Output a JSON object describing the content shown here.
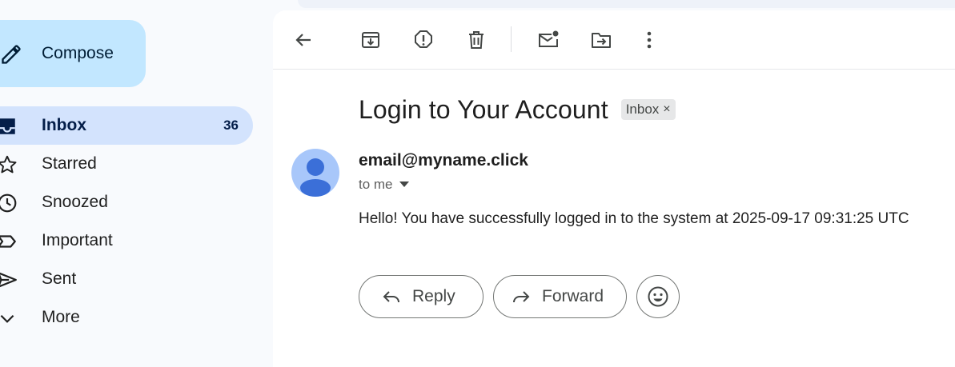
{
  "sidebar": {
    "compose_label": "Compose",
    "items": [
      {
        "label": "Inbox",
        "count": "36",
        "icon": "inbox-icon",
        "active": true
      },
      {
        "label": "Starred",
        "icon": "star-icon"
      },
      {
        "label": "Snoozed",
        "icon": "clock-icon"
      },
      {
        "label": "Important",
        "icon": "important-icon"
      },
      {
        "label": "Sent",
        "icon": "send-icon"
      },
      {
        "label": "More",
        "icon": "chevron-down-icon"
      }
    ]
  },
  "toolbar": {
    "icons": [
      "back-arrow-icon",
      "archive-icon",
      "report-spam-icon",
      "delete-icon",
      "mark-unread-icon",
      "move-to-icon",
      "more-vert-icon"
    ]
  },
  "message": {
    "subject": "Login to Your Account",
    "label_chip": "Inbox",
    "label_chip_close": "×",
    "sender": "email@myname.click",
    "to": "to me",
    "body": "Hello! You have successfully logged in to the system at 2025-09-17 09:31:25 UTC"
  },
  "actions": {
    "reply": "Reply",
    "forward": "Forward"
  },
  "colors": {
    "compose_bg": "#c2e7ff",
    "active_nav_bg": "#d3e3fd",
    "avatar_bg": "#a8c7fa",
    "avatar_fg": "#3b6fd8"
  }
}
